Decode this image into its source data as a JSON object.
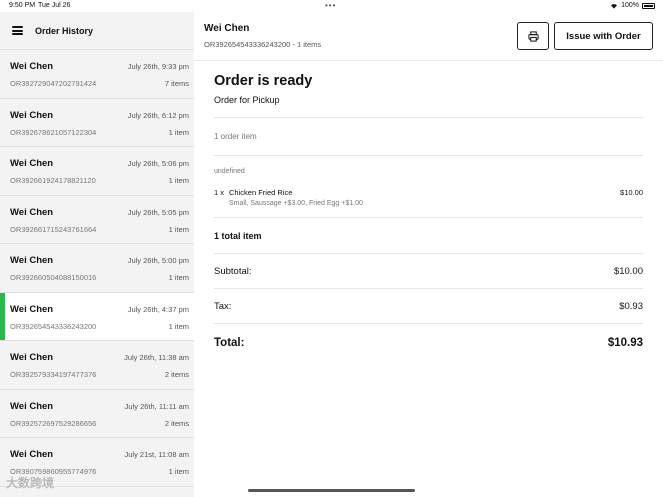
{
  "status_bar": {
    "time": "9:50 PM",
    "date": "Tue Jul 26",
    "battery": "100%"
  },
  "sidebar": {
    "title": "Order History",
    "orders": [
      {
        "name": "Wei Chen",
        "date": "July 26th, 9:33 pm",
        "id": "OR392729047202791424",
        "count": "7 items"
      },
      {
        "name": "Wei Chen",
        "date": "July 26th, 6:12 pm",
        "id": "OR392678621057122304",
        "count": "1 item"
      },
      {
        "name": "Wei Chen",
        "date": "July 26th, 5:06 pm",
        "id": "OR392661924178821120",
        "count": "1 item"
      },
      {
        "name": "Wei Chen",
        "date": "July 26th, 5:05 pm",
        "id": "OR392661715243761664",
        "count": "1 item"
      },
      {
        "name": "Wei Chen",
        "date": "July 26th, 5:00 pm",
        "id": "OR392660504088150016",
        "count": "1 item"
      },
      {
        "name": "Wei Chen",
        "date": "July 26th, 4:37 pm",
        "id": "OR392654543336243200",
        "count": "1 item",
        "selected": true
      },
      {
        "name": "Wei Chen",
        "date": "July 26th, 11:38 am",
        "id": "OR392579334197477376",
        "count": "2 items"
      },
      {
        "name": "Wei Chen",
        "date": "July 26th, 11:11 am",
        "id": "OR392572697529286656",
        "count": "2 items"
      },
      {
        "name": "Wei Chen",
        "date": "July 21st, 11:08 am",
        "id": "OR390759860955774976",
        "count": "1 item"
      }
    ]
  },
  "main": {
    "customer_name": "Wei Chen",
    "order_summary": "OR392654543336243200 - 1 items",
    "issue_label": "Issue with Order",
    "status_title": "Order is ready",
    "status_subtitle": "Order for Pickup",
    "item_count_label": "1 order item",
    "section_label": "undefined",
    "line_item": {
      "qty": "1 x",
      "name": "Chicken Fried Rice",
      "price": "$10.00",
      "modifiers": "Small, Saussage +$3.00, Fried Egg +$1.00"
    },
    "total_items_label": "1 total item",
    "subtotal_label": "Subtotal:",
    "subtotal_value": "$10.00",
    "tax_label": "Tax:",
    "tax_value": "$0.93",
    "total_label": "Total:",
    "total_value": "$10.93"
  },
  "watermark": "大数跨境",
  "colors": {
    "accent": "#2bb84a"
  }
}
